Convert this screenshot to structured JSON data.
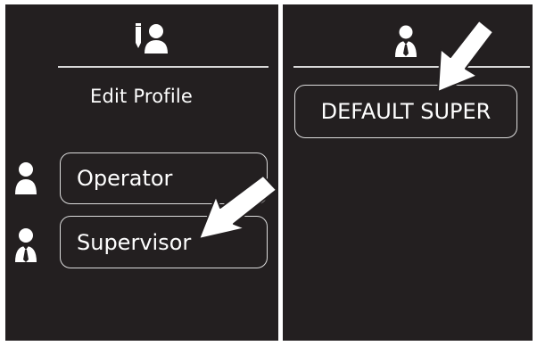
{
  "left_panel": {
    "header_icon": "edit-profile-icon",
    "title": "Edit Profile",
    "items": [
      {
        "label": "Operator",
        "icon": "operator-icon"
      },
      {
        "label": "Supervisor",
        "icon": "supervisor-icon"
      }
    ]
  },
  "right_panel": {
    "header_icon": "supervisor-icon",
    "items": [
      {
        "label": "DEFAULT SUPER"
      }
    ]
  },
  "colors": {
    "background": "#231f20",
    "foreground": "#ffffff",
    "outline": "#dcdcdc"
  }
}
